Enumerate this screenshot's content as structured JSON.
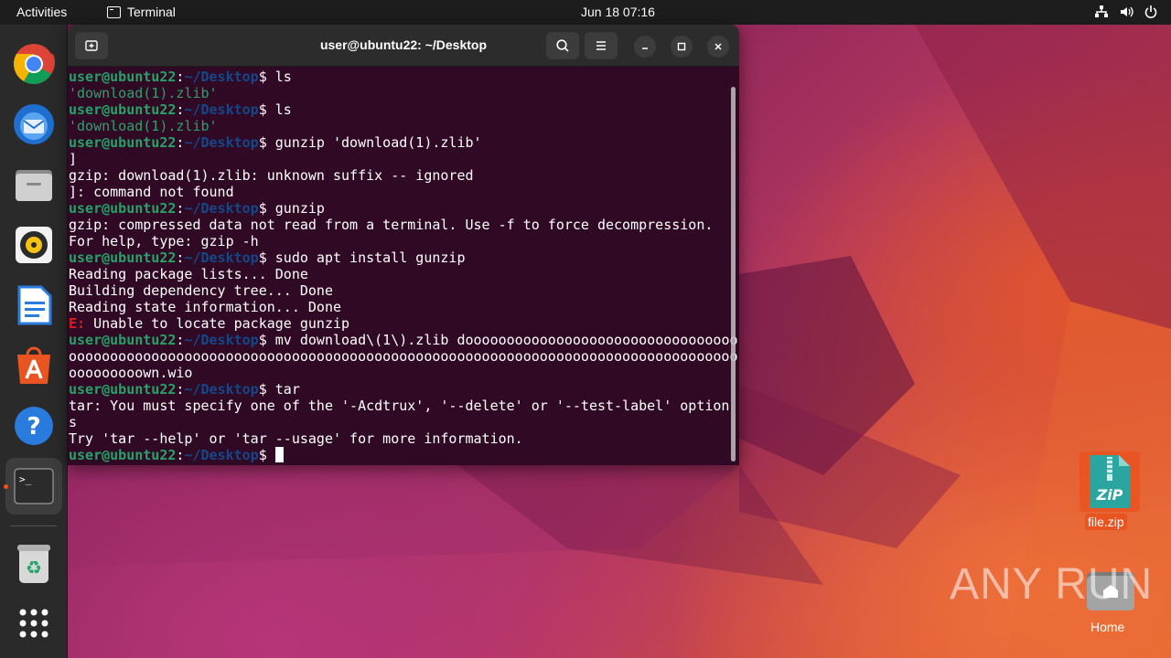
{
  "topbar": {
    "activities": "Activities",
    "app_name": "Terminal",
    "clock": "Jun 18  07:16"
  },
  "dock": {
    "items": [
      "chrome-icon",
      "thunderbird-icon",
      "files-icon",
      "rhythmbox-icon",
      "writer-icon",
      "app-center-icon",
      "help-icon",
      "terminal-icon",
      "trash-icon",
      "show-apps-icon"
    ]
  },
  "terminal": {
    "title": "user@ubuntu22: ~/Desktop",
    "prompt_user": "user@ubuntu22",
    "prompt_path": "~/Desktop",
    "lines": [
      {
        "type": "cmd",
        "text": "ls"
      },
      {
        "type": "quoted",
        "text": "'download(1).zlib'"
      },
      {
        "type": "cmd",
        "text": "ls"
      },
      {
        "type": "quoted",
        "text": "'download(1).zlib'"
      },
      {
        "type": "cmd",
        "text": "gunzip 'download(1).zlib'"
      },
      {
        "type": "out",
        "text": "]"
      },
      {
        "type": "out",
        "text": "gzip: download(1).zlib: unknown suffix -- ignored"
      },
      {
        "type": "out",
        "text": "]: command not found"
      },
      {
        "type": "cmd",
        "text": "gunzip"
      },
      {
        "type": "out",
        "text": "gzip: compressed data not read from a terminal. Use -f to force decompression."
      },
      {
        "type": "out",
        "text": "For help, type: gzip -h"
      },
      {
        "type": "cmd",
        "text": "sudo apt install gunzip"
      },
      {
        "type": "out",
        "text": "Reading package lists... Done"
      },
      {
        "type": "out",
        "text": "Building dependency tree... Done"
      },
      {
        "type": "out",
        "text": "Reading state information... Done"
      },
      {
        "type": "error",
        "prefix": "E:",
        "text": " Unable to locate package gunzip"
      },
      {
        "type": "cmd",
        "text": "mv download\\(1\\).zlib dooooooooooooooooooooooooooooooooo"
      },
      {
        "type": "out",
        "text": "ooooooooooooooooooooooooooooooooooooooooooooooooooooooooooooooooooooooooooooooooo"
      },
      {
        "type": "out",
        "text": "ooooooooown.wio"
      },
      {
        "type": "cmd",
        "text": "tar"
      },
      {
        "type": "out",
        "text": "tar: You must specify one of the '-Acdtrux', '--delete' or '--test-label' option"
      },
      {
        "type": "out",
        "text": "s"
      },
      {
        "type": "out",
        "text": "Try 'tar --help' or 'tar --usage' for more information."
      },
      {
        "type": "prompt",
        "text": ""
      }
    ]
  },
  "desktop": {
    "zip_label": "file.zip",
    "zip_badge": "ZiP",
    "home_label": "Home",
    "watermark": "ANY RUN"
  }
}
